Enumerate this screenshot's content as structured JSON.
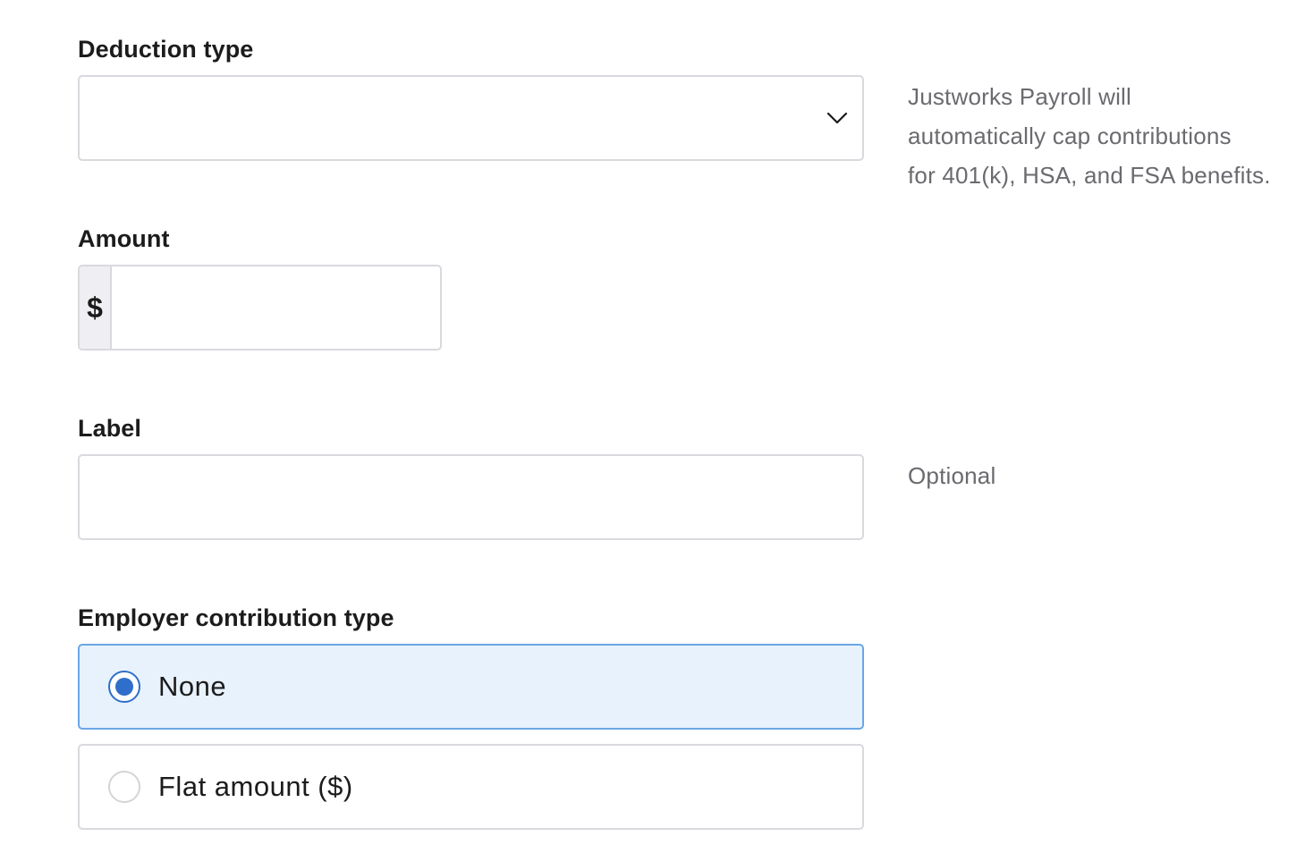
{
  "deduction_type": {
    "label": "Deduction type",
    "selected_value": "",
    "helper_text_lines": [
      "Justworks Payroll will",
      "automatically cap contributions",
      "for 401(k), HSA, and FSA benefits."
    ]
  },
  "amount": {
    "label": "Amount",
    "currency_symbol": "$",
    "value": ""
  },
  "label_field": {
    "label": "Label",
    "value": "",
    "helper_text": "Optional"
  },
  "employer_contribution": {
    "label": "Employer contribution type",
    "options": [
      {
        "label": "None",
        "selected": true
      },
      {
        "label": "Flat amount ($)",
        "selected": false
      }
    ]
  },
  "colors": {
    "accent": "#2f6fcb",
    "selected_bg": "#e8f2fc",
    "selected_border": "#6aa6e6",
    "border": "#d9d9de",
    "helper_text": "#6a6a6f"
  },
  "icons": {
    "select_chevron": "chevron-down-icon"
  }
}
